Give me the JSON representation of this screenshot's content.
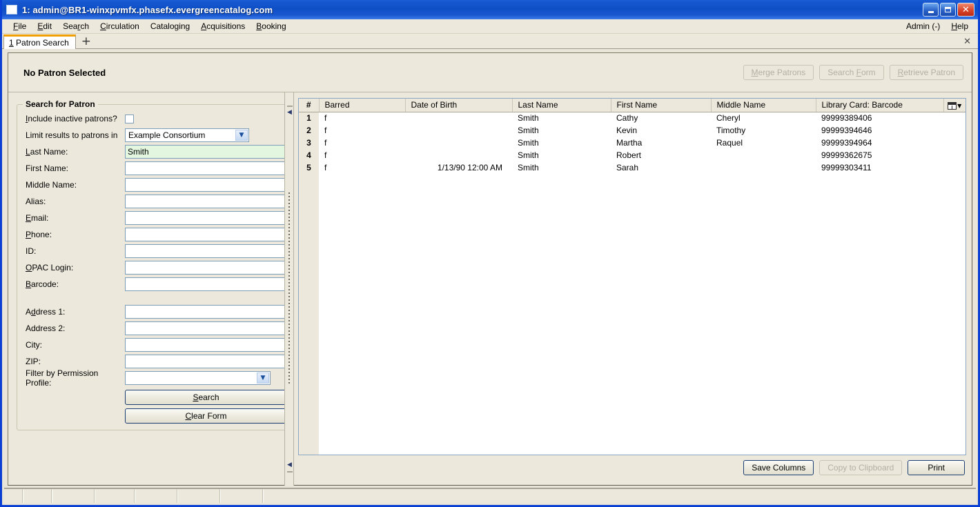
{
  "window": {
    "title": "1: admin@BR1-winxpvmfx.phasefx.evergreencatalog.com",
    "icon": "window-icon",
    "minimize_label": "_",
    "maximize_label": "□",
    "close_label": "✕"
  },
  "menubar": {
    "items": [
      {
        "label": "File",
        "accel": "F"
      },
      {
        "label": "Edit",
        "accel": "E"
      },
      {
        "label": "Search",
        "accel": "r"
      },
      {
        "label": "Circulation",
        "accel": "C"
      },
      {
        "label": "Cataloging",
        "accel": "g"
      },
      {
        "label": "Acquisitions",
        "accel": "A"
      },
      {
        "label": "Booking",
        "accel": "B"
      }
    ],
    "right_items": [
      {
        "label": "Admin (-)"
      },
      {
        "label": "Help",
        "accel": "H"
      }
    ]
  },
  "tabbar": {
    "tabs": [
      {
        "number": "1",
        "label": "Patron Search",
        "active": true
      }
    ],
    "new_tab_label": "+",
    "close_label": "✕"
  },
  "patron_header": {
    "title": "No Patron Selected",
    "buttons": [
      {
        "label": "Merge Patrons",
        "disabled": true
      },
      {
        "label": "Search Form",
        "disabled": true
      },
      {
        "label": "Retrieve Patron",
        "disabled": true
      }
    ]
  },
  "search_form": {
    "legend": "Search for Patron",
    "include_inactive": {
      "label": "Include inactive patrons?",
      "checked": false
    },
    "limit_results": {
      "label": "Limit results to patrons in",
      "value": "Example Consortium"
    },
    "fields": [
      {
        "label": "Last Name:",
        "value": "Smith",
        "active": true
      },
      {
        "label": "First Name:",
        "value": ""
      },
      {
        "label": "Middle Name:",
        "value": ""
      },
      {
        "label": "Alias:",
        "value": ""
      },
      {
        "label": "Email:",
        "value": ""
      },
      {
        "label": "Phone:",
        "value": ""
      },
      {
        "label": "ID:",
        "value": ""
      },
      {
        "label": "OPAC Login:",
        "value": ""
      },
      {
        "label": "Barcode:",
        "value": ""
      }
    ],
    "address_fields": [
      {
        "label": "Address 1:",
        "value": ""
      },
      {
        "label": "Address 2:",
        "value": ""
      },
      {
        "label": "City:",
        "value": ""
      },
      {
        "label": "ZIP:",
        "value": ""
      }
    ],
    "permission_profile": {
      "label": "Filter by Permission Profile:",
      "value": ""
    },
    "search_button": "Search",
    "clear_button": "Clear Form"
  },
  "results": {
    "columns": [
      "#",
      "Barred",
      "Date of Birth",
      "Last Name",
      "First Name",
      "Middle Name",
      "Library Card: Barcode"
    ],
    "column_picker_icon": "column-picker-icon",
    "rows": [
      {
        "n": "1",
        "barred": "f",
        "dob": "",
        "last": "Smith",
        "first": "Cathy",
        "middle": "Cheryl",
        "barcode": "99999389406"
      },
      {
        "n": "2",
        "barred": "f",
        "dob": "",
        "last": "Smith",
        "first": "Kevin",
        "middle": "Timothy",
        "barcode": "99999394646"
      },
      {
        "n": "3",
        "barred": "f",
        "dob": "",
        "last": "Smith",
        "first": "Martha",
        "middle": "Raquel",
        "barcode": "99999394964"
      },
      {
        "n": "4",
        "barred": "f",
        "dob": "",
        "last": "Smith",
        "first": "Robert",
        "middle": "",
        "barcode": "99999362675"
      },
      {
        "n": "5",
        "barred": "f",
        "dob": "1/13/90 12:00 AM",
        "last": "Smith",
        "first": "Sarah",
        "middle": "",
        "barcode": "99999303411"
      }
    ],
    "buttons": [
      {
        "label": "Save Columns",
        "disabled": false
      },
      {
        "label": "Copy to Clipboard",
        "disabled": true
      },
      {
        "label": "Print",
        "disabled": false
      }
    ]
  },
  "statusbar": {
    "cells": [
      "",
      "",
      "",
      "",
      "",
      "",
      "",
      ""
    ]
  },
  "colors": {
    "titlebar": "#0f4fc6",
    "chrome": "#ece9dc",
    "active_tab_accent": "#f0a000",
    "field_active_bg": "#e3f7e0",
    "field_border": "#7f9db9"
  }
}
